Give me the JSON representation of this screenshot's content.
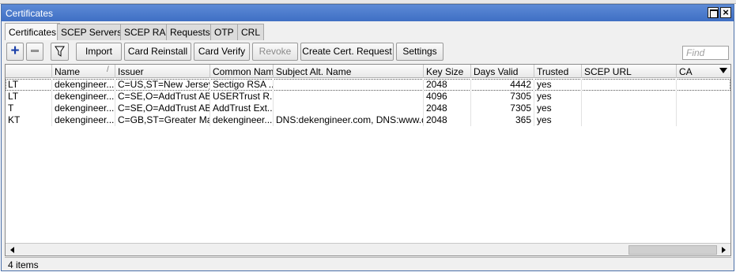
{
  "window": {
    "title": "Certificates"
  },
  "tabs": [
    {
      "label": "Certificates",
      "active": true
    },
    {
      "label": "SCEP Servers"
    },
    {
      "label": "SCEP RA"
    },
    {
      "label": "Requests"
    },
    {
      "label": "OTP"
    },
    {
      "label": "CRL"
    }
  ],
  "toolbar": {
    "add_icon": "plus-icon",
    "remove_icon": "minus-icon",
    "filter_icon": "filter-icon",
    "import": "Import",
    "card_reinstall": "Card Reinstall",
    "card_verify": "Card Verify",
    "revoke": "Revoke",
    "create_request": "Create Cert. Request",
    "settings": "Settings",
    "find_placeholder": "Find"
  },
  "table": {
    "columns": [
      "",
      "Name",
      "Issuer",
      "Common Name",
      "Subject Alt. Name",
      "Key Size",
      "Days Valid",
      "Trusted",
      "SCEP URL",
      "CA"
    ],
    "rows": [
      {
        "flags": "LT",
        "name": "dekengineer....",
        "issuer": "C=US,ST=New Jersey...",
        "common_name": "Sectigo RSA ...",
        "san": "",
        "key_size": "2048",
        "days_valid": "4442",
        "trusted": "yes",
        "scep_url": "",
        "ca": ""
      },
      {
        "flags": "LT",
        "name": "dekengineer....",
        "issuer": "C=SE,O=AddTrust AB...",
        "common_name": "USERTrust R...",
        "san": "",
        "key_size": "4096",
        "days_valid": "7305",
        "trusted": "yes",
        "scep_url": "",
        "ca": ""
      },
      {
        "flags": "T",
        "name": "dekengineer....",
        "issuer": "C=SE,O=AddTrust AB...",
        "common_name": "AddTrust Ext...",
        "san": "",
        "key_size": "2048",
        "days_valid": "7305",
        "trusted": "yes",
        "scep_url": "",
        "ca": ""
      },
      {
        "flags": "KT",
        "name": "dekengineer....",
        "issuer": "C=GB,ST=Greater Ma...",
        "common_name": "dekengineer....",
        "san": "DNS:dekengineer.com, DNS:www.d...",
        "key_size": "2048",
        "days_valid": "365",
        "trusted": "yes",
        "scep_url": "",
        "ca": ""
      }
    ]
  },
  "status": {
    "items": "4 items"
  }
}
